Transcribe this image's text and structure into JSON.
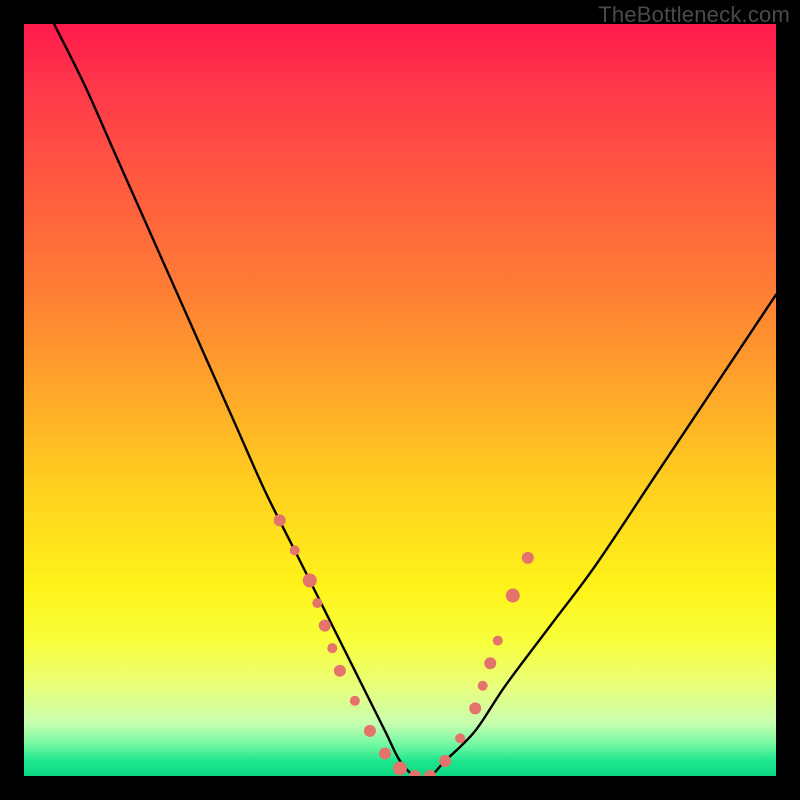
{
  "watermark": "TheBottleneck.com",
  "chart_data": {
    "type": "line",
    "title": "",
    "xlabel": "",
    "ylabel": "",
    "xlim": [
      0,
      100
    ],
    "ylim": [
      0,
      100
    ],
    "series": [
      {
        "name": "curve",
        "x": [
          4,
          8,
          12,
          16,
          20,
          24,
          28,
          32,
          36,
          40,
          44,
          48,
          50,
          52,
          54,
          56,
          60,
          64,
          70,
          76,
          84,
          92,
          100
        ],
        "y": [
          100,
          92,
          83,
          74,
          65,
          56,
          47,
          38,
          30,
          22,
          14,
          6,
          2,
          0,
          0,
          2,
          6,
          12,
          20,
          28,
          40,
          52,
          64
        ]
      }
    ],
    "markers": {
      "name": "highlight-dots",
      "color": "#e4736b",
      "points": [
        {
          "x": 34,
          "y": 34,
          "r": 6
        },
        {
          "x": 36,
          "y": 30,
          "r": 5
        },
        {
          "x": 38,
          "y": 26,
          "r": 7
        },
        {
          "x": 39,
          "y": 23,
          "r": 5
        },
        {
          "x": 40,
          "y": 20,
          "r": 6
        },
        {
          "x": 41,
          "y": 17,
          "r": 5
        },
        {
          "x": 42,
          "y": 14,
          "r": 6
        },
        {
          "x": 44,
          "y": 10,
          "r": 5
        },
        {
          "x": 46,
          "y": 6,
          "r": 6
        },
        {
          "x": 48,
          "y": 3,
          "r": 6
        },
        {
          "x": 50,
          "y": 1,
          "r": 7
        },
        {
          "x": 52,
          "y": 0,
          "r": 6
        },
        {
          "x": 54,
          "y": 0,
          "r": 6
        },
        {
          "x": 56,
          "y": 2,
          "r": 6
        },
        {
          "x": 58,
          "y": 5,
          "r": 5
        },
        {
          "x": 60,
          "y": 9,
          "r": 6
        },
        {
          "x": 61,
          "y": 12,
          "r": 5
        },
        {
          "x": 62,
          "y": 15,
          "r": 6
        },
        {
          "x": 63,
          "y": 18,
          "r": 5
        },
        {
          "x": 65,
          "y": 24,
          "r": 7
        },
        {
          "x": 67,
          "y": 29,
          "r": 6
        }
      ]
    }
  }
}
